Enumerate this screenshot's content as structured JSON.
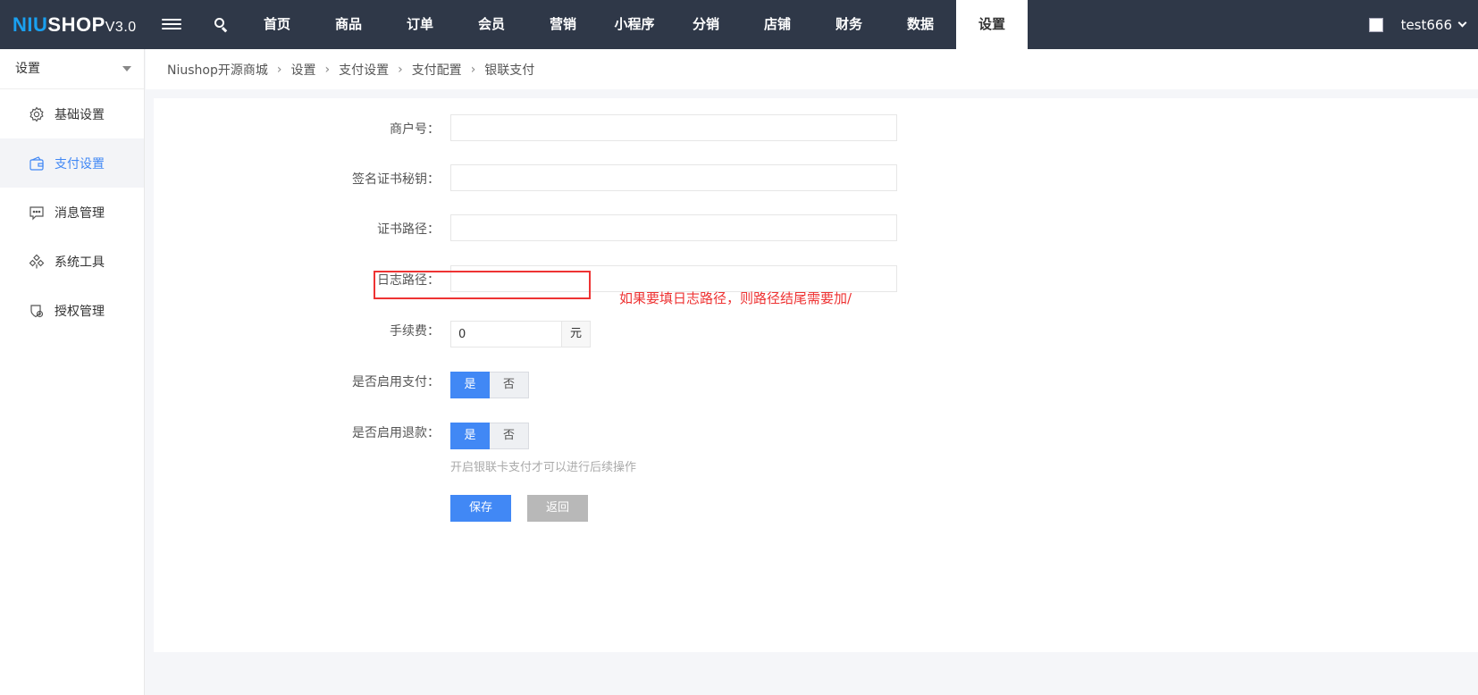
{
  "header": {
    "logo_brand_a": "NIU",
    "logo_brand_b": "SHOP",
    "logo_version": "V3.0",
    "nav": [
      "首页",
      "商品",
      "订单",
      "会员",
      "营销",
      "小程序",
      "分销",
      "店铺",
      "财务",
      "数据",
      "设置"
    ],
    "active_nav": "设置",
    "username": "test666"
  },
  "sidebar": {
    "title": "设置",
    "items": [
      {
        "label": "基础设置",
        "icon": "gear-icon"
      },
      {
        "label": "支付设置",
        "icon": "wallet-icon",
        "active": true
      },
      {
        "label": "消息管理",
        "icon": "message-icon"
      },
      {
        "label": "系统工具",
        "icon": "tool-icon"
      },
      {
        "label": "授权管理",
        "icon": "shield-icon"
      }
    ]
  },
  "breadcrumb": [
    "Niushop开源商城",
    "设置",
    "支付设置",
    "支付配置",
    "银联支付"
  ],
  "form": {
    "merchant_label": "商户号：",
    "merchant_value": "",
    "cert_key_label": "签名证书秘钥：",
    "cert_key_value": "",
    "cert_path_label": "证书路径：",
    "cert_path_value": "",
    "log_path_label": "日志路径：",
    "log_path_value": "",
    "fee_label": "手续费：",
    "fee_value": "0",
    "fee_unit": "元",
    "enable_pay_label": "是否启用支付：",
    "enable_refund_label": "是否启用退款：",
    "yes": "是",
    "no": "否",
    "hint": "开启银联卡支付才可以进行后续操作",
    "save": "保存",
    "back": "返回"
  },
  "annotation": "如果要填日志路径，则路径结尾需要加/",
  "colors": {
    "topbar": "#2f3848",
    "accent": "#4188f5",
    "annotation": "#ee3333"
  }
}
